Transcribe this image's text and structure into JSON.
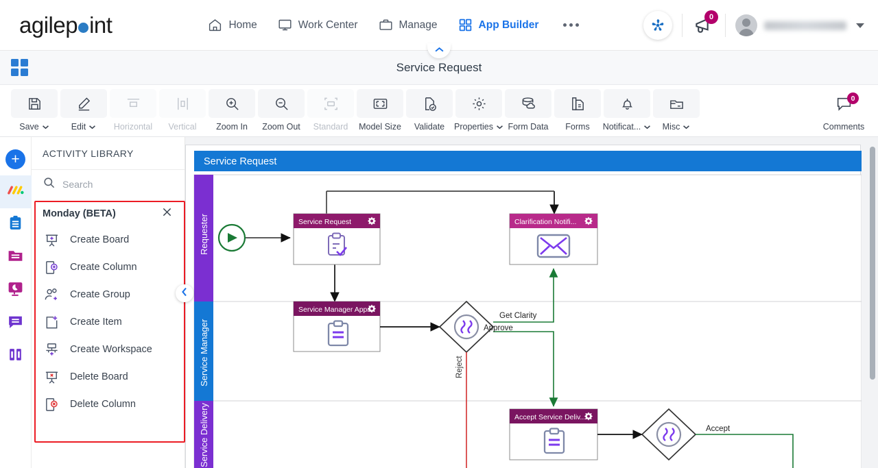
{
  "header": {
    "logo": {
      "part1": "agilep",
      "dot": "point-dot",
      "part2": "int"
    },
    "nav": [
      {
        "label": "Home",
        "icon": "home-icon",
        "active": false
      },
      {
        "label": "Work Center",
        "icon": "monitor-icon",
        "active": false
      },
      {
        "label": "Manage",
        "icon": "briefcase-icon",
        "active": false
      },
      {
        "label": "App Builder",
        "icon": "grid-icon",
        "active": true
      }
    ],
    "overflow": "more-options-icon",
    "app_switcher_icon": "agilepoint-app-icon",
    "announcements": {
      "icon": "megaphone-icon",
      "badge": "0"
    },
    "user": {
      "avatar": "user-avatar",
      "name_blurred": true,
      "caret": "chevron-down-icon"
    }
  },
  "titlebar": {
    "grid_icon": "app-grid-icon",
    "title": "Service Request",
    "collapse_icon": "chevron-up-icon"
  },
  "toolbar": {
    "items": [
      {
        "label": "Save",
        "icon": "save-icon",
        "dropdown": true,
        "disabled": false
      },
      {
        "label": "Edit",
        "icon": "edit-pencil-icon",
        "dropdown": true,
        "disabled": false
      },
      {
        "label": "Horizontal",
        "icon": "horizontal-align-icon",
        "dropdown": false,
        "disabled": true
      },
      {
        "label": "Vertical",
        "icon": "vertical-align-icon",
        "dropdown": false,
        "disabled": true
      },
      {
        "label": "Zoom In",
        "icon": "zoom-in-icon",
        "dropdown": false,
        "disabled": false
      },
      {
        "label": "Zoom Out",
        "icon": "zoom-out-icon",
        "dropdown": false,
        "disabled": false
      },
      {
        "label": "Standard",
        "icon": "standard-size-icon",
        "dropdown": false,
        "disabled": true
      },
      {
        "label": "Model Size",
        "icon": "model-size-icon",
        "dropdown": false,
        "disabled": false
      },
      {
        "label": "Validate",
        "icon": "validate-icon",
        "dropdown": false,
        "disabled": false
      },
      {
        "label": "Properties",
        "icon": "gear-icon",
        "dropdown": true,
        "disabled": false
      },
      {
        "label": "Form Data",
        "icon": "database-icon",
        "dropdown": false,
        "disabled": false
      },
      {
        "label": "Forms",
        "icon": "forms-icon",
        "dropdown": false,
        "disabled": false
      },
      {
        "label": "Notificat...",
        "icon": "bell-icon",
        "dropdown": true,
        "disabled": false
      },
      {
        "label": "Misc",
        "icon": "misc-folder-icon",
        "dropdown": true,
        "disabled": false
      }
    ],
    "comments": {
      "label": "Comments",
      "icon": "comment-icon",
      "badge": "0"
    }
  },
  "rail": {
    "add_label": "+",
    "items": [
      {
        "name": "add-button",
        "icon": "plus-circle-icon",
        "active": false
      },
      {
        "name": "monday-logo",
        "icon": "monday-icon",
        "active": true
      },
      {
        "name": "tasks",
        "icon": "clipboard-icon",
        "active": false
      },
      {
        "name": "files",
        "icon": "folder-icon",
        "active": false
      },
      {
        "name": "reports",
        "icon": "chart-monitor-icon",
        "active": false
      },
      {
        "name": "messages",
        "icon": "comment-bubble-icon",
        "active": false
      },
      {
        "name": "columns",
        "icon": "columns-icon",
        "active": false
      }
    ]
  },
  "panel": {
    "title": "ACTIVITY LIBRARY",
    "search": {
      "placeholder": "Search",
      "value": "",
      "icon": "search-icon"
    },
    "group": {
      "name": "Monday (BETA)",
      "close_icon": "close-icon"
    },
    "activities": [
      {
        "label": "Create Board",
        "icon": "create-board-icon"
      },
      {
        "label": "Create Column",
        "icon": "create-column-icon"
      },
      {
        "label": "Create Group",
        "icon": "create-group-icon"
      },
      {
        "label": "Create Item",
        "icon": "create-item-icon"
      },
      {
        "label": "Create Workspace",
        "icon": "create-workspace-icon"
      },
      {
        "label": "Delete Board",
        "icon": "delete-board-icon"
      },
      {
        "label": "Delete Column",
        "icon": "delete-column-icon"
      }
    ],
    "collapse_icon": "chevron-left-icon",
    "highlight_color": "#ec1c24"
  },
  "diagram": {
    "title": "Service Request",
    "lanes": [
      {
        "label": "Requester",
        "color": "#7b2fd1"
      },
      {
        "label": "Service Manager",
        "color": "#1478d4"
      },
      {
        "label": "Service Delivery",
        "color": "#7b2fd1"
      }
    ],
    "start_event": {
      "name": "start-event",
      "icon": "play-icon",
      "color": "#1a7a35"
    },
    "tasks": [
      {
        "label": "Service Request",
        "icon": "form-task-icon",
        "gear": "gear-icon",
        "header_color": "#8e1a6b"
      },
      {
        "label": "Clarification Notifi...",
        "icon": "email-icon",
        "gear": "gear-icon",
        "header_color": "#b82a8a"
      },
      {
        "label": "Service Manager Appr...",
        "icon": "approval-task-icon",
        "gear": "gear-icon",
        "header_color": "#7a1560"
      },
      {
        "label": "Accept Service Deliv...",
        "icon": "approval-task-icon",
        "gear": "gear-icon",
        "header_color": "#7a1560"
      }
    ],
    "gateways": [
      {
        "name": "approval-gateway",
        "icon": "gateway-icon"
      },
      {
        "name": "acceptance-gateway",
        "icon": "gateway-icon"
      }
    ],
    "flow_labels": [
      {
        "text": "Get Clarity",
        "color": "#2e7d32"
      },
      {
        "text": "Approve",
        "color": "#2e7d32"
      },
      {
        "text": "Reject",
        "color": "#d32f2f"
      },
      {
        "text": "Accept",
        "color": "#2e7d32"
      }
    ],
    "scrollbar": "vertical-scrollbar"
  }
}
